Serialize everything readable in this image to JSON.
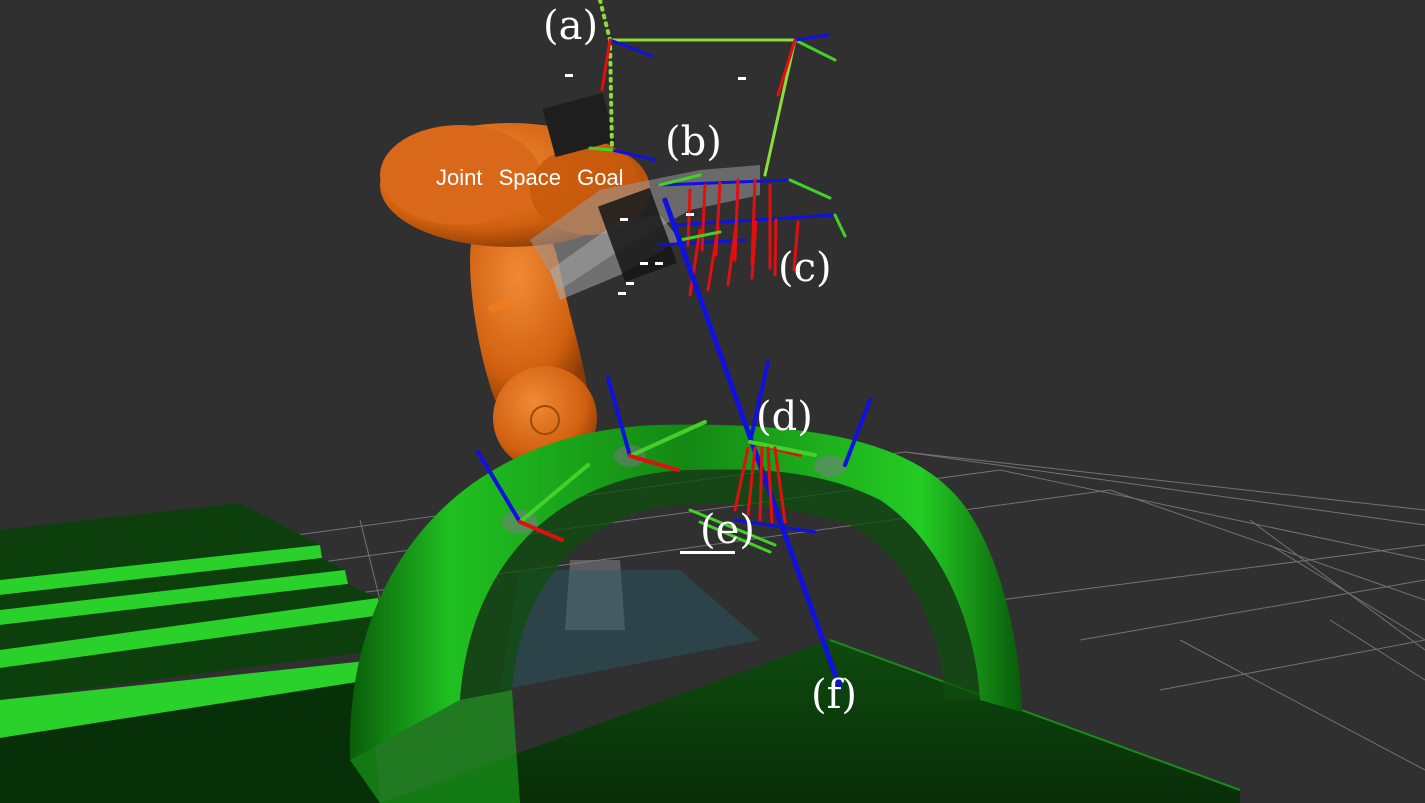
{
  "viewport": {
    "background_color": "#303030",
    "grid_color": "#9a9a9a"
  },
  "colors": {
    "robot_orange": "#d35f0e",
    "fixture_green": "#1fc21f",
    "floor_green": "#0b3a0b",
    "axis_x": "#e01010",
    "axis_y": "#44d02a",
    "axis_z": "#1010e0",
    "path_yellowgreen": "#8cdc3a"
  },
  "scene": {
    "goal_caption": "Joint Space Goal",
    "labels": {
      "a": "(a)",
      "b": "(b)",
      "c": "(c)",
      "d": "(d)",
      "e": "(e)",
      "f": "(f)"
    }
  },
  "icons": {
    "robot_arm": "robot-arm-icon",
    "gripper": "gripper-icon",
    "fixture": "arch-fixture-icon",
    "frames": "tf-frame-icon"
  }
}
